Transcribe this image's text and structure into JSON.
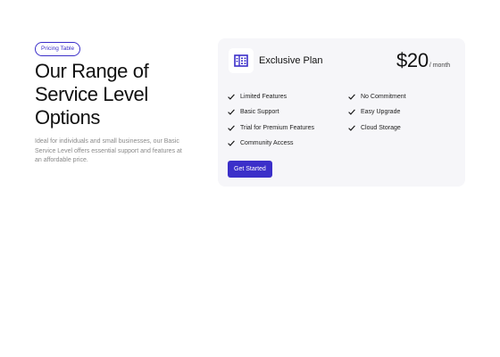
{
  "section": {
    "badge": "Pricing Table",
    "headline_lines": [
      "Our Range of",
      "Service Level",
      "Options"
    ],
    "description_lines": [
      "Ideal for individuals and small businesses, our Basic",
      "Service Level offers essential support and features at",
      "an affordable price."
    ]
  },
  "plan": {
    "icon": "building-icon",
    "name": "Exclusive Plan",
    "price": "$20",
    "period": "/ month",
    "features_left": [
      "Limited Features",
      "Basic Support",
      "Trial for Premium Features",
      "Community Access"
    ],
    "features_right": [
      "No Commitment",
      "Easy Upgrade",
      "Cloud Storage"
    ],
    "cta_label": "Get Started"
  },
  "colors": {
    "accent": "#3b2fc9",
    "card_bg": "#f6f6f9",
    "text": "#111111",
    "muted": "#8a8a8a"
  }
}
